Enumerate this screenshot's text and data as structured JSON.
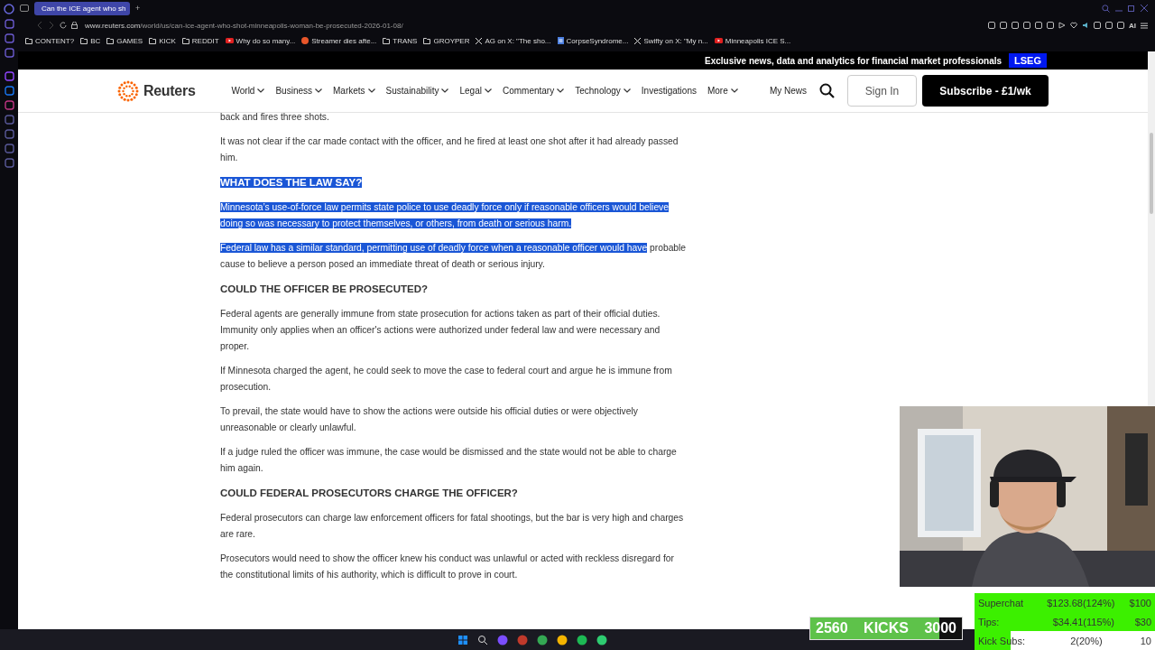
{
  "browser": {
    "tab": {
      "title": "Can the ICE agent who sh",
      "selected": true
    },
    "url_domain": "www.reuters.com",
    "url_path": "/world/us/can-ice-agent-who-shot-minneapolis-woman-be-prosecuted-2026-01-08/",
    "ai_label": "AI",
    "new_tab": "+",
    "bookmarks": [
      {
        "label": "CONTENT?",
        "kind": "folder"
      },
      {
        "label": "BC",
        "kind": "folder"
      },
      {
        "label": "GAMES",
        "kind": "folder"
      },
      {
        "label": "KICK",
        "kind": "folder"
      },
      {
        "label": "REDDIT",
        "kind": "folder"
      },
      {
        "label": "Why do so many...",
        "kind": "video"
      },
      {
        "label": "Streamer dies afte...",
        "kind": "avatar"
      },
      {
        "label": "TRANS",
        "kind": "folder"
      },
      {
        "label": "GROYPER",
        "kind": "folder"
      },
      {
        "label": "AG on X: \"The sho...",
        "kind": "x"
      },
      {
        "label": "CorpseSyndrome...",
        "kind": "doc"
      },
      {
        "label": "Swifty on X: \"My n...",
        "kind": "x"
      },
      {
        "label": "Minneapolis ICE S...",
        "kind": "video"
      }
    ]
  },
  "site": {
    "promo": "Exclusive news, data and analytics for financial market professionals",
    "promo_badge": "LSEG",
    "logo": "Reuters",
    "nav": [
      {
        "label": "World",
        "dropdown": true
      },
      {
        "label": "Business",
        "dropdown": true
      },
      {
        "label": "Markets",
        "dropdown": true
      },
      {
        "label": "Sustainability",
        "dropdown": true
      },
      {
        "label": "Legal",
        "dropdown": true
      },
      {
        "label": "Commentary",
        "dropdown": true
      },
      {
        "label": "Technology",
        "dropdown": true
      },
      {
        "label": "Investigations",
        "dropdown": false
      },
      {
        "label": "More",
        "dropdown": true
      }
    ],
    "my_news": "My News",
    "sign_in": "Sign In",
    "subscribe": "Subscribe - £1/wk"
  },
  "article": [
    {
      "kind": "paragraph",
      "parts": [
        {
          "text": "back and fires three shots.",
          "selected": false
        }
      ]
    },
    {
      "kind": "paragraph",
      "parts": [
        {
          "text": "It was not clear if the car made contact with the officer, and he fired at least one shot after it had already passed him.",
          "selected": false
        }
      ]
    },
    {
      "kind": "heading",
      "parts": [
        {
          "text": "WHAT DOES THE LAW SAY?",
          "selected": true
        }
      ]
    },
    {
      "kind": "paragraph",
      "parts": [
        {
          "text": "Minnesota’s use-of-force law permits state police to use deadly force only if reasonable officers would believe doing so was necessary to protect themselves, or others, from death or serious harm.",
          "selected": true
        }
      ]
    },
    {
      "kind": "paragraph",
      "parts": [
        {
          "text": "Federal law has a similar standard, permitting use of deadly force when a reasonable officer would have",
          "selected": true
        },
        {
          "text": " probable cause to believe a person posed an immediate threat of death or serious injury.",
          "selected": false
        }
      ]
    },
    {
      "kind": "heading",
      "parts": [
        {
          "text": "COULD THE OFFICER BE PROSECUTED?",
          "selected": false
        }
      ]
    },
    {
      "kind": "paragraph",
      "parts": [
        {
          "text": "Federal agents are generally immune from state prosecution for actions taken as part of their official duties. Immunity only applies when an officer's actions were authorized under federal law and were necessary and proper.",
          "selected": false
        }
      ]
    },
    {
      "kind": "paragraph",
      "parts": [
        {
          "text": "If Minnesota charged the agent, he could seek to move the case to federal court and argue he is immune from prosecution.",
          "selected": false
        }
      ]
    },
    {
      "kind": "paragraph",
      "parts": [
        {
          "text": "To prevail, the state would have to show the actions were outside his official duties or were objectively unreasonable or clearly unlawful.",
          "selected": false
        }
      ]
    },
    {
      "kind": "paragraph",
      "parts": [
        {
          "text": "If a judge ruled the officer was immune, the case would be dismissed and the state would not be able to charge him again.",
          "selected": false
        }
      ]
    },
    {
      "kind": "heading",
      "parts": [
        {
          "text": "COULD FEDERAL PROSECUTORS CHARGE THE OFFICER?",
          "selected": false
        }
      ]
    },
    {
      "kind": "paragraph",
      "parts": [
        {
          "text": "Federal prosecutors can charge law enforcement officers for fatal shootings, but the bar is very high and charges are rare.",
          "selected": false
        }
      ]
    },
    {
      "kind": "paragraph",
      "parts": [
        {
          "text": "Prosecutors would need to show the officer knew his conduct was unlawful or acted with reckless disregard for the constitutional limits of his authority, which is difficult to prove in court.",
          "selected": false
        }
      ]
    }
  ],
  "kicks": {
    "current": "2560",
    "label": "KICKS",
    "goal": "3000",
    "level": 0.853
  },
  "stats": [
    {
      "label": "Superchat",
      "amount": "$123.68(124%)",
      "goal": "$100",
      "level": 1
    },
    {
      "label": "Tips:",
      "amount": "$34.41(115%)",
      "goal": "$30",
      "level": 1
    },
    {
      "label": "Kick Subs:",
      "amount": "2(20%)",
      "goal": "10",
      "level": 0.2
    }
  ]
}
